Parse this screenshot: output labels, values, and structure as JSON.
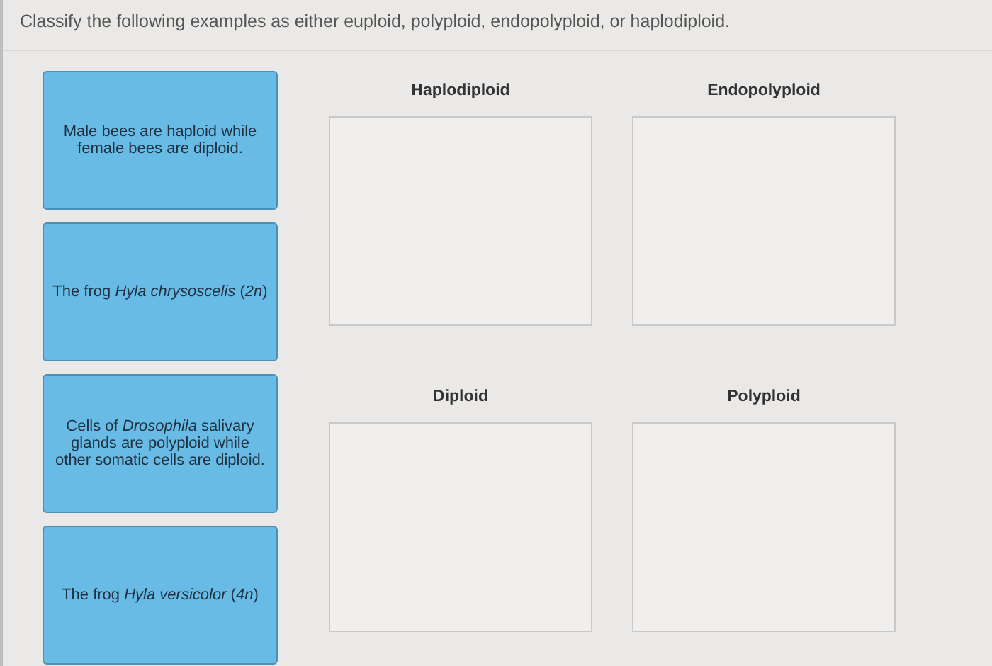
{
  "instruction": "Classify the following examples as either euploid, polyploid, endopolyploid, or haplodiploid.",
  "cards": [
    {
      "text": "Male bees are haploid while female bees are diploid."
    },
    {
      "text": "The frog *Hyla chrysoscelis* (*2n*)"
    },
    {
      "text": "Cells of *Drosophila* salivary glands are polyploid while other somatic cells are diploid."
    },
    {
      "text": "The frog *Hyla versicolor* (*4n*)"
    }
  ],
  "categories": [
    {
      "label": "Haplodiploid"
    },
    {
      "label": "Endopolyploid"
    },
    {
      "label": "Diploid"
    },
    {
      "label": "Polyploid"
    }
  ]
}
